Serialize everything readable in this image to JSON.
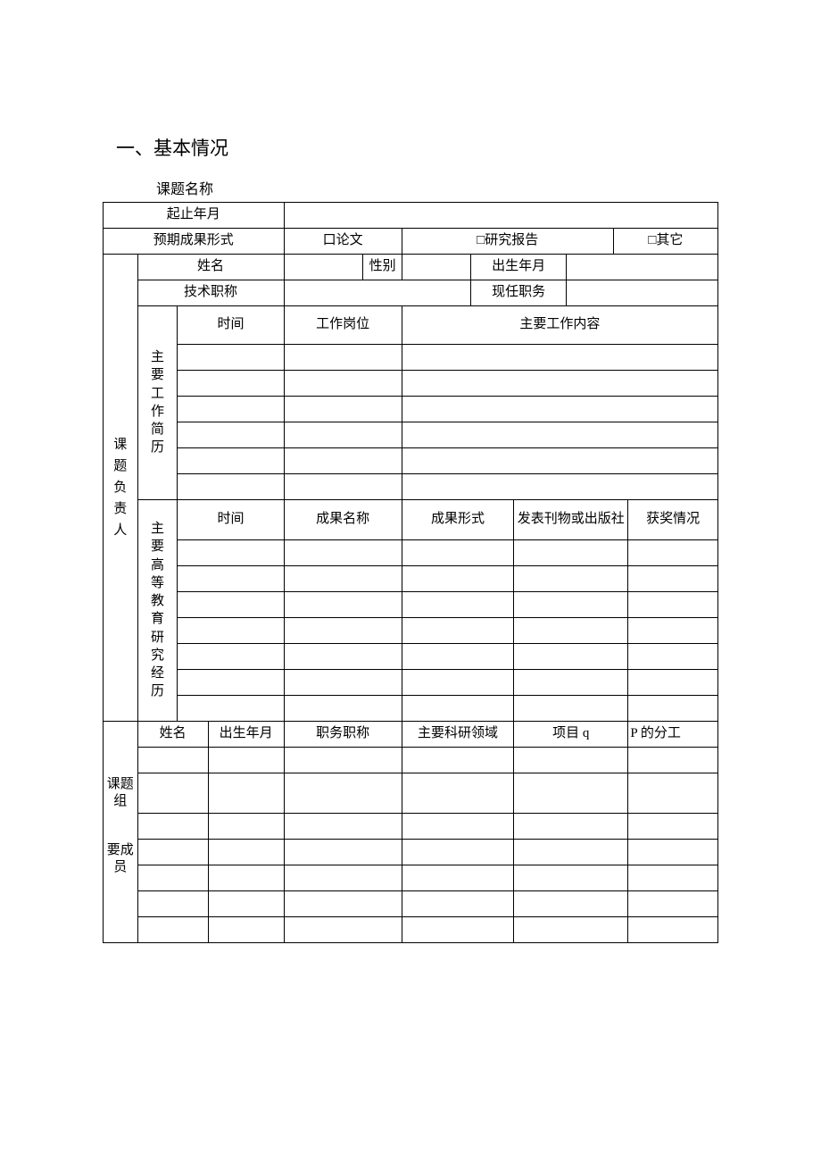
{
  "section_title": "一、基本情况",
  "labels": {
    "topic_name": "课题名称",
    "period": "起止年月",
    "expected_form": "预期成果形式",
    "form_paper": "口论文",
    "form_report": "□研究报告",
    "form_other": "□其它",
    "name": "姓名",
    "gender": "性别",
    "birth": "出生年月",
    "tech_title": "技术职称",
    "current_post": "现任职务",
    "leader": "课题负责人",
    "work_history": "主要工作简历",
    "time": "时间",
    "work_post": "工作岗位",
    "main_work": "主要工作内容",
    "edu_research": "主要高等教育研究经历",
    "result_name": "成果名称",
    "result_form": "成果形式",
    "publication": "发表刊物或出版社",
    "awards": "获奖情况",
    "members": "课题组要成员",
    "members_1": "课题组",
    "members_2": "要成员",
    "birth2": "出生年月",
    "post_title": "职务职称",
    "research_area": "主要科研领域",
    "project_q": "项目 q",
    "p_division": "P 的分工"
  }
}
